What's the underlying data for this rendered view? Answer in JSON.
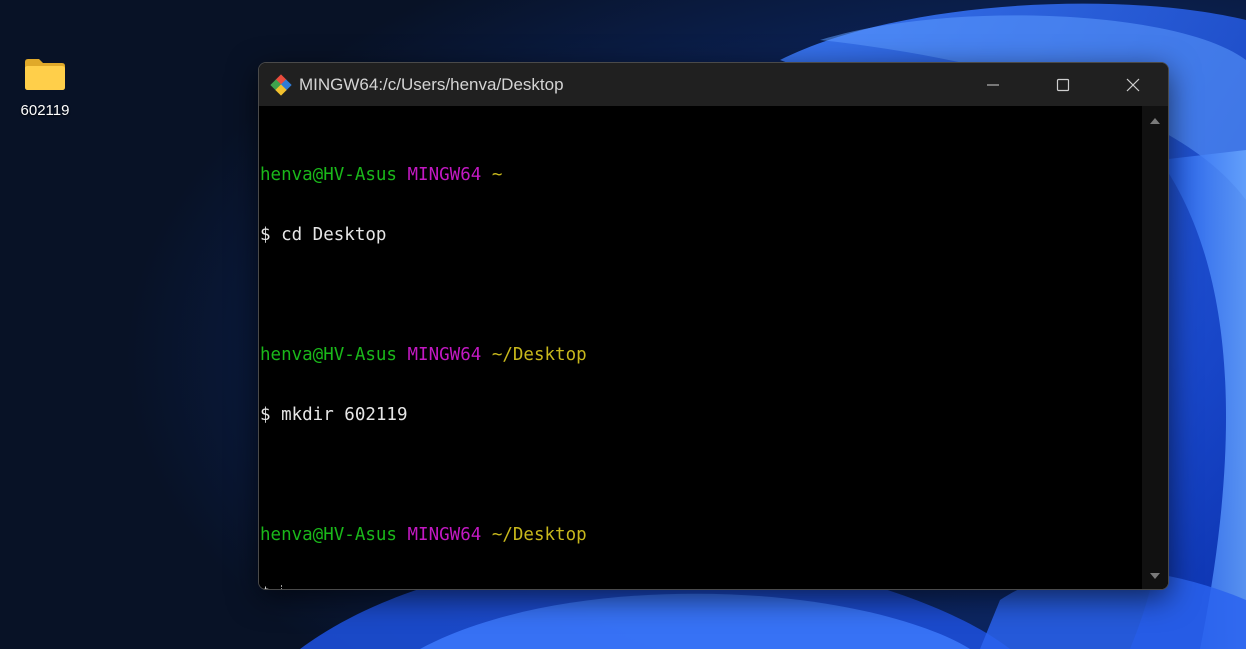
{
  "desktop": {
    "icons": [
      {
        "label": "602119",
        "icon": "folder-icon"
      }
    ]
  },
  "window": {
    "title": "MINGW64:/c/Users/henva/Desktop",
    "app_icon": "git-icon",
    "buttons": [
      "minimize-icon",
      "maximize-icon",
      "close-icon"
    ]
  },
  "terminal": {
    "prompts": [
      {
        "user_host": "henva@HV-Asus",
        "shell": "MINGW64",
        "path": "~",
        "command": "$ cd Desktop"
      },
      {
        "user_host": "henva@HV-Asus",
        "shell": "MINGW64",
        "path": "~/Desktop",
        "command": "$ mkdir 602119"
      },
      {
        "user_host": "henva@HV-Asus",
        "shell": "MINGW64",
        "path": "~/Desktop",
        "command": "$"
      }
    ]
  },
  "colors": {
    "user_host": "#1ab81a",
    "shell": "#c319c3",
    "path": "#c8b81c",
    "text": "#e6e6e6"
  }
}
